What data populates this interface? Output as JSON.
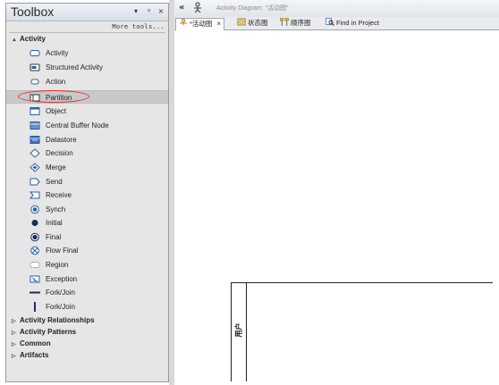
{
  "toolbox": {
    "title": "Toolbox",
    "controls": [
      "▾",
      "ᵖ",
      "×"
    ],
    "more_tools": "More tools...",
    "active_group": "Activity",
    "items": [
      {
        "label": "Activity",
        "icon": "activity-icon"
      },
      {
        "label": "Structured Activity",
        "icon": "structured-activity-icon"
      },
      {
        "label": "Action",
        "icon": "action-icon"
      },
      {
        "label": "Partition",
        "icon": "partition-icon",
        "selected": true
      },
      {
        "label": "Object",
        "icon": "object-icon"
      },
      {
        "label": "Central Buffer Node",
        "icon": "central-buffer-node-icon"
      },
      {
        "label": "Datastore",
        "icon": "datastore-icon"
      },
      {
        "label": "Decision",
        "icon": "decision-icon"
      },
      {
        "label": "Merge",
        "icon": "merge-icon"
      },
      {
        "label": "Send",
        "icon": "send-icon"
      },
      {
        "label": "Receive",
        "icon": "receive-icon"
      },
      {
        "label": "Synch",
        "icon": "synch-icon"
      },
      {
        "label": "Initial",
        "icon": "initial-icon"
      },
      {
        "label": "Final",
        "icon": "final-icon"
      },
      {
        "label": "Flow Final",
        "icon": "flow-final-icon"
      },
      {
        "label": "Region",
        "icon": "region-icon"
      },
      {
        "label": "Exception",
        "icon": "exception-icon"
      },
      {
        "label": "Fork/Join",
        "icon": "fork-join-horizontal-icon"
      },
      {
        "label": "Fork/Join",
        "icon": "fork-join-vertical-icon"
      }
    ],
    "collapsed_groups": [
      "Activity Relationships",
      "Activity Patterns",
      "Common",
      "Artifacts"
    ]
  },
  "editor": {
    "nav_back": "«",
    "doc_title": "Activity Diagram: \"活动图\"",
    "tabs": [
      {
        "label": "*活动图",
        "active": true,
        "closable": true
      },
      {
        "label": "状态图",
        "active": false
      },
      {
        "label": "顺序图",
        "active": false
      },
      {
        "label": "Find in Project",
        "active": false
      }
    ],
    "close_glyph": "×"
  },
  "diagram": {
    "partition_label": "用户"
  },
  "colors": {
    "selection_marker": "#e03030",
    "toolbox_bg": "#e6e6e6",
    "selected_item_bg": "#c9c9c9"
  }
}
